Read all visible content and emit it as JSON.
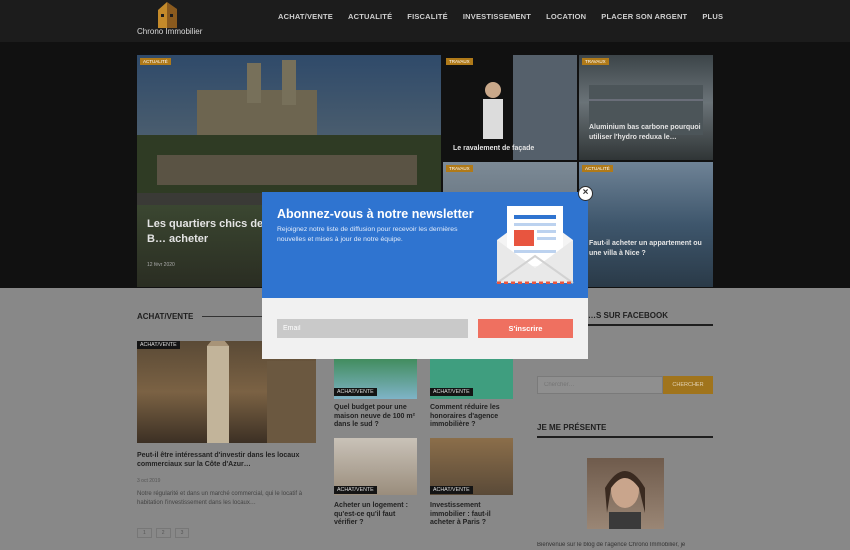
{
  "site": {
    "logo_text": "Chrono Immobilier"
  },
  "nav": [
    "ACHAT/VENTE",
    "ACTUALITÉ",
    "FISCALITÉ",
    "INVESTISSEMENT",
    "LOCATION",
    "PLACER SON ARGENT",
    "PLUS"
  ],
  "hero": {
    "main": {
      "tag": "ACTUALITÉ",
      "title": "Les quartiers chics de B… acheter",
      "date": "12 févr 2020"
    },
    "tiles": [
      {
        "tag": "TRAVAUX",
        "title": "Le ravalement de façade"
      },
      {
        "tag": "TRAVAUX",
        "title": "Aluminium bas carbone pourquoi utiliser l'hydro reduxa le…"
      },
      {
        "tag": "TRAVAUX",
        "title": ""
      },
      {
        "tag": "ACTUALITÉ",
        "title": "Faut-il acheter un appartement ou une villa à Nice ?"
      }
    ]
  },
  "section": {
    "heading": "ACHAT/VENTE",
    "featured": {
      "tag": "ACHAT/VENTE",
      "title": "Peut-il être intéressant d'investir dans les locaux commerciaux sur la Côte d'Azur…",
      "date": "3 oct 2019",
      "excerpt": "Notre régularité et dans un marché commercial, qui le locatif à habitation l'investissement dans les locaux…",
      "pager": [
        "1",
        "2",
        "3"
      ]
    },
    "articles": [
      {
        "tag": "ACHAT/VENTE",
        "title": "Quel budget pour une maison neuve de 100 m² dans le sud ?"
      },
      {
        "tag": "ACHAT/VENTE",
        "title": "Comment réduire les honoraires d'agence immobilière ?"
      },
      {
        "tag": "ACHAT/VENTE",
        "title": "Acheter un logement : qu'est-ce qu'il faut vérifier ?"
      },
      {
        "tag": "ACHAT/VENTE",
        "title": "Investissement immobilier : faut-il acheter à Paris ?"
      }
    ]
  },
  "sidebar": {
    "facebook_heading": "…S SUR FACEBOOK",
    "search_placeholder": "Chercher…",
    "search_button": "CHERCHER",
    "about_heading": "JE ME PRÉSENTE",
    "about_text": "Bienvenue sur le blog de l'agence Chrono Immobilier, je"
  },
  "popup": {
    "title": "Abonnez-vous à notre newsletter",
    "description": "Rejoignez notre liste de diffusion pour recevoir les dernières nouvelles et mises à jour de notre équipe.",
    "email_placeholder": "Email",
    "subscribe_label": "S'inscrire",
    "close_glyph": "×"
  },
  "colors": {
    "popup_blue": "#2f74d0",
    "button_coral": "#ef7060",
    "tag_gold": "#b07a19"
  }
}
